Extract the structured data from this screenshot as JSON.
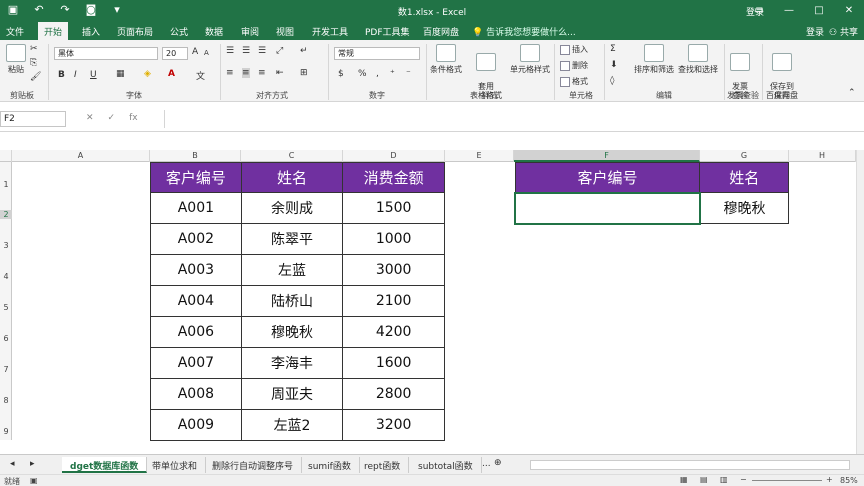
{
  "title_bar": {
    "doc_title": "数1.xlsx - Excel",
    "login": "登录",
    "controls": [
      "—",
      "□",
      "✕"
    ]
  },
  "tabs": [
    "文件",
    "开始",
    "插入",
    "页面布局",
    "公式",
    "数据",
    "审阅",
    "视图",
    "开发工具",
    "PDF工具集",
    "百度网盘"
  ],
  "active_tab": "开始",
  "tell_me": "告诉我您想要做什么...",
  "share": "共享",
  "ribbon": {
    "clipboard": {
      "label": "剪贴板",
      "paste": "粘贴"
    },
    "font": {
      "label": "字体",
      "name": "黑体",
      "size": "20",
      "bold": "B",
      "italic": "I",
      "underline": "U",
      "grow": "A",
      "shrink": "A"
    },
    "alignment": {
      "label": "对齐方式"
    },
    "number": {
      "label": "数字",
      "format": "常规"
    },
    "styles": {
      "label": "样式",
      "cond": "条件格式",
      "table": "套用\n表格格式",
      "cell": "单元格样式"
    },
    "cells": {
      "label": "单元格",
      "insert": "插入",
      "delete": "删除",
      "format": "格式"
    },
    "editing": {
      "label": "编辑",
      "sort": "排序和筛选",
      "find": "查找和选择"
    },
    "invoice": {
      "label": "发票查验",
      "btn": "发票\n查验"
    },
    "save": {
      "label": "保存",
      "btn": "保存到\n百度网盘"
    }
  },
  "name_box": "F2",
  "fx": "fx",
  "columns": [
    "A",
    "B",
    "C",
    "D",
    "E",
    "F",
    "G",
    "H"
  ],
  "selected_column": "F",
  "rows": [
    "1",
    "2",
    "3",
    "4",
    "5",
    "6",
    "7",
    "8",
    "9"
  ],
  "selected_row": "2",
  "main_table": {
    "headers": [
      "客户编号",
      "姓名",
      "消费金额"
    ],
    "rows": [
      [
        "A001",
        "余则成",
        "1500"
      ],
      [
        "A002",
        "陈翠平",
        "1000"
      ],
      [
        "A003",
        "左蓝",
        "3000"
      ],
      [
        "A004",
        "陆桥山",
        "2100"
      ],
      [
        "A006",
        "穆晚秋",
        "4200"
      ],
      [
        "A007",
        "李海丰",
        "1600"
      ],
      [
        "A008",
        "周亚夫",
        "2800"
      ],
      [
        "A009",
        "左蓝2",
        "3200"
      ]
    ]
  },
  "lookup_table": {
    "headers": [
      "客户编号",
      "姓名"
    ],
    "values": [
      "",
      "穆晚秋"
    ]
  },
  "sheets": [
    "dget数据库函数",
    "带单位求和",
    "删除行自动调整序号",
    "sumif函数",
    "rept函数",
    "subtotal函数",
    "..."
  ],
  "active_sheet": "dget数据库函数",
  "status": {
    "ready": "就绪",
    "zoom": "85%"
  },
  "colors": {
    "excel_green": "#217346",
    "header_purple": "#7030a0"
  }
}
